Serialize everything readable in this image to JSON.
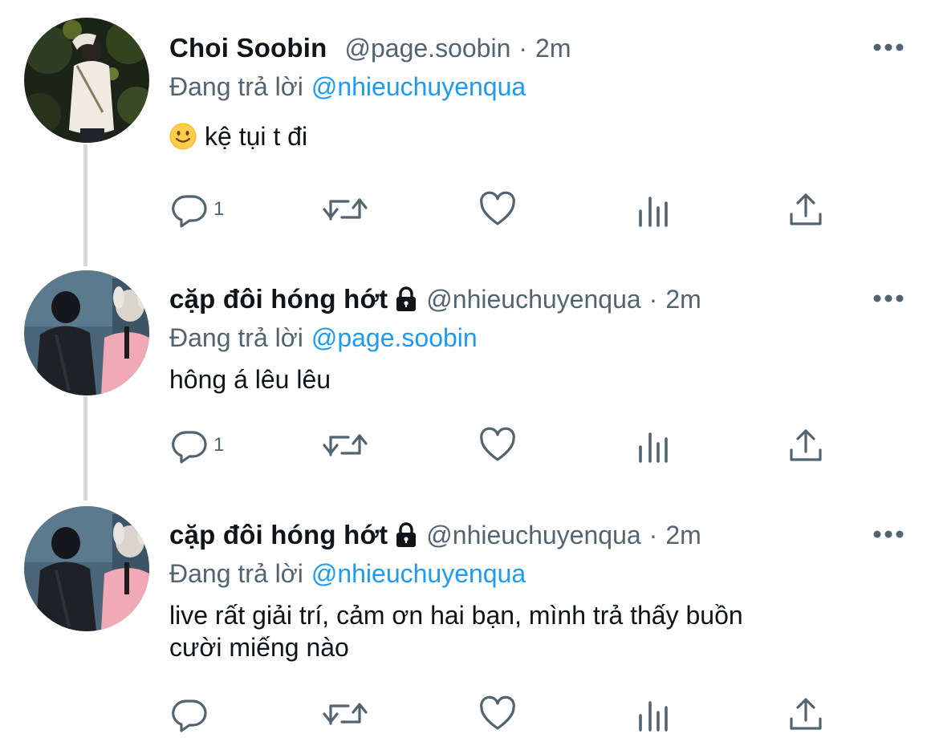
{
  "tweets": [
    {
      "name": "Choi Soobin",
      "locked": false,
      "handle": "@page.soobin",
      "separator": "·",
      "time": "2m",
      "reply_prefix": "Đang trả lời",
      "reply_to": "@nhieuchuyenqua",
      "emoji": "slightly-smiling-face-icon",
      "text": "kệ tụi t đi",
      "reply_count": "1"
    },
    {
      "name": "cặp đôi hóng hớt",
      "locked": true,
      "handle": "@nhieuchuyenqua",
      "separator": "·",
      "time": "2m",
      "reply_prefix": "Đang trả lời",
      "reply_to": "@page.soobin",
      "text": "hông á lêu lêu",
      "reply_count": "1"
    },
    {
      "name": "cặp đôi hóng hớt",
      "locked": true,
      "handle": "@nhieuchuyenqua",
      "separator": "·",
      "time": "2m",
      "reply_prefix": "Đang trả lời",
      "reply_to": "@nhieuchuyenqua",
      "text_line1": "live rất giải trí, cảm ơn hai bạn, mình trả thấy buồn",
      "text_line2": "cười miếng nào",
      "reply_count": ""
    }
  ],
  "colors": {
    "text": "#0f1419",
    "secondary": "#536471",
    "link": "#1d9bf0",
    "thread_line": "#cfd9de"
  }
}
